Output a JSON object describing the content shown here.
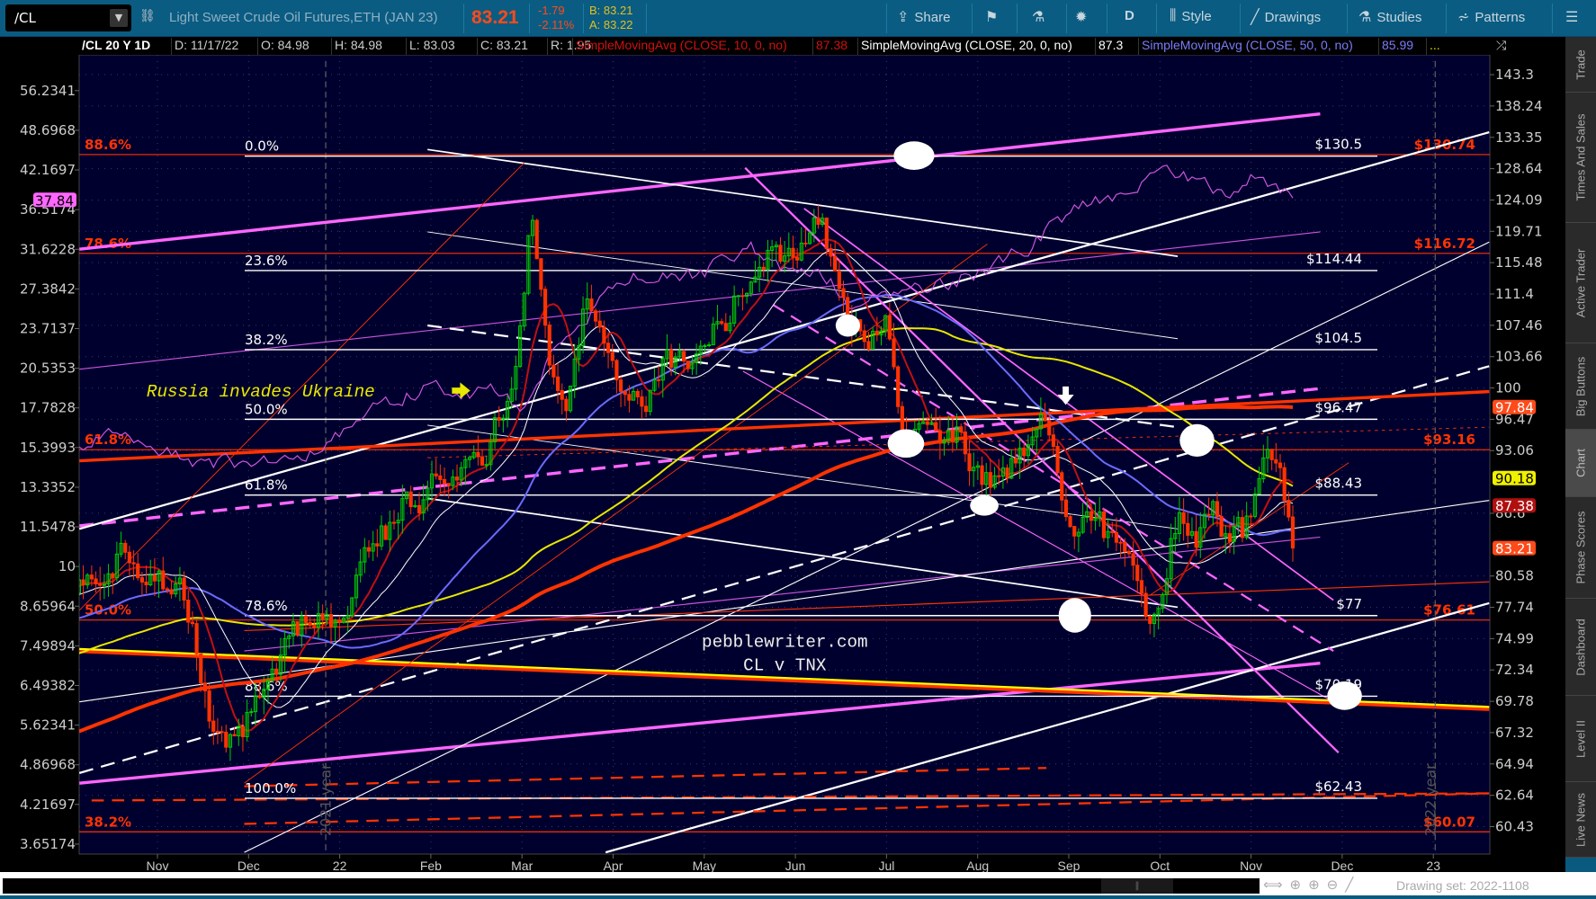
{
  "toolbar": {
    "symbol": "/CL",
    "description": "Light Sweet Crude Oil Futures,ETH (JAN 23)",
    "last": "83.21",
    "change": "-1.79",
    "change_pct": "-2.11%",
    "bid": "B: 83.21",
    "ask": "A: 83.22",
    "share": "Share",
    "period": "D",
    "style": "Style",
    "drawings": "Drawings",
    "studies": "Studies",
    "patterns": "Patterns"
  },
  "info_bar": {
    "title": "/CL 20 Y 1D",
    "date": "D: 11/17/22",
    "open": "O: 84.98",
    "high": "H: 84.98",
    "low": "L: 83.03",
    "close": "C: 83.21",
    "range": "R: 1.95",
    "sma10": "SimpleMovingAvg (CLOSE, 10, 0, no)",
    "sma10_val": "87.38",
    "sma20": "SimpleMovingAvg (CLOSE, 20, 0, no)",
    "sma20_val": "87.3",
    "sma50": "SimpleMovingAvg (CLOSE, 50, 0, no)",
    "sma50_val": "85.99",
    "more": "..."
  },
  "side_tabs": [
    "Trade",
    "Times And Sales",
    "Active Trader",
    "Big Buttons",
    "Chart",
    "Phase Scores",
    "Dashboard",
    "Level II",
    "Live News"
  ],
  "bottom": {
    "drawing_set": "Drawing set: 2022-1108"
  },
  "colors": {
    "bg": "#00002e",
    "up": "#00cc00",
    "down": "#ff3300",
    "sma10": "#c01010",
    "sma20": "#ffffff",
    "sma50": "#6b6bff",
    "sma100": "#e8e800",
    "sma200": "#ff3300",
    "tnx": "#cc55dd",
    "fib": "#ffffff",
    "fib_red": "#ff3300"
  },
  "chart_data": {
    "type": "candlestick",
    "title": "/CL 20 Y 1D",
    "right_axis_ticks": [
      "143.3",
      "138.24",
      "133.35",
      "128.64",
      "124.09",
      "119.71",
      "115.48",
      "111.4",
      "107.46",
      "103.66",
      "100",
      "96.47",
      "93.06",
      "86.6",
      "80.58",
      "77.74",
      "74.99",
      "72.34",
      "69.78",
      "67.32",
      "64.94",
      "62.64",
      "60.43"
    ],
    "left_axis_ticks": [
      "56.2341",
      "48.6968",
      "42.1697",
      "36.5174",
      "31.6228",
      "27.3842",
      "23.7137",
      "20.5353",
      "17.7828",
      "15.3993",
      "13.3352",
      "11.5478",
      "10",
      "8.65964",
      "7.49894",
      "6.49382",
      "5.62341",
      "4.86968",
      "4.21697",
      "3.65174"
    ],
    "x_ticks": [
      "Nov",
      "Dec",
      "22",
      "Feb",
      "Mar",
      "Apr",
      "May",
      "Jun",
      "Jul",
      "Aug",
      "Sep",
      "Oct",
      "Nov",
      "Dec",
      "23"
    ],
    "price_markers": [
      {
        "label": "97.84",
        "color": "#ff4a1a",
        "text": "#ffffff"
      },
      {
        "label": "90.18",
        "color": "#f0f000",
        "text": "#000000"
      },
      {
        "label": "87.38",
        "color": "#b01010",
        "text": "#ffffff"
      },
      {
        "label": "83.21",
        "color": "#ff4a1a",
        "text": "#ffffff"
      }
    ],
    "left_marker": {
      "label": "37.84",
      "color": "#ff66ff"
    },
    "price_path_month_index": [
      [
        -0.86,
        80
      ],
      [
        -0.5,
        83
      ],
      [
        0,
        81
      ],
      [
        0.3,
        78
      ],
      [
        0.6,
        68
      ],
      [
        0.85,
        66
      ],
      [
        1.2,
        72
      ],
      [
        1.6,
        76
      ],
      [
        2.0,
        77
      ],
      [
        2.3,
        83
      ],
      [
        2.8,
        88
      ],
      [
        3.2,
        92
      ],
      [
        3.6,
        92
      ],
      [
        3.9,
        100
      ],
      [
        4.1,
        123
      ],
      [
        4.3,
        105
      ],
      [
        4.5,
        100
      ],
      [
        4.7,
        112
      ],
      [
        5.0,
        100
      ],
      [
        5.3,
        98
      ],
      [
        5.6,
        103
      ],
      [
        6.0,
        105
      ],
      [
        6.3,
        110
      ],
      [
        6.6,
        115
      ],
      [
        7.0,
        118
      ],
      [
        7.3,
        120
      ],
      [
        7.5,
        110
      ],
      [
        7.7,
        107
      ],
      [
        8.0,
        108
      ],
      [
        8.2,
        95
      ],
      [
        8.5,
        97
      ],
      [
        8.8,
        95
      ],
      [
        9.1,
        90
      ],
      [
        9.4,
        92
      ],
      [
        9.7,
        96
      ],
      [
        10.0,
        87
      ],
      [
        10.3,
        86
      ],
      [
        10.6,
        82
      ],
      [
        10.85,
        77
      ],
      [
        11.0,
        79
      ],
      [
        11.2,
        87
      ],
      [
        11.4,
        85
      ],
      [
        11.6,
        86
      ],
      [
        11.9,
        84
      ],
      [
        12.1,
        88
      ],
      [
        12.2,
        92
      ],
      [
        12.35,
        88
      ],
      [
        12.5,
        83.21
      ]
    ],
    "tnx_path_month_index": [
      [
        -0.86,
        15.5
      ],
      [
        -0.5,
        16
      ],
      [
        0,
        15.2
      ],
      [
        0.5,
        14.5
      ],
      [
        1.0,
        14.6
      ],
      [
        1.5,
        14.8
      ],
      [
        2.0,
        16
      ],
      [
        2.3,
        17.5
      ],
      [
        2.7,
        18.5
      ],
      [
        3.0,
        19.3
      ],
      [
        3.3,
        18.6
      ],
      [
        3.8,
        19
      ],
      [
        4.0,
        17.5
      ],
      [
        4.3,
        21
      ],
      [
        4.7,
        24
      ],
      [
        5.0,
        28
      ],
      [
        5.3,
        29
      ],
      [
        5.6,
        28.5
      ],
      [
        6.0,
        29
      ],
      [
        6.5,
        32
      ],
      [
        6.7,
        30
      ],
      [
        7.0,
        28.5
      ],
      [
        7.3,
        29
      ],
      [
        7.6,
        26
      ],
      [
        8.0,
        27
      ],
      [
        8.5,
        27.8
      ],
      [
        9.0,
        29
      ],
      [
        9.4,
        31
      ],
      [
        9.7,
        33
      ],
      [
        10.0,
        36
      ],
      [
        10.3,
        38
      ],
      [
        10.6,
        39
      ],
      [
        11.0,
        42
      ],
      [
        11.3,
        41
      ],
      [
        11.5,
        40
      ],
      [
        11.8,
        39
      ],
      [
        12.1,
        42
      ],
      [
        12.3,
        39
      ],
      [
        12.5,
        37.84
      ]
    ],
    "fib_levels": [
      {
        "pct": "0.0%",
        "price": 130.5,
        "label": "$130.5"
      },
      {
        "pct": "23.6%",
        "price": 114.44,
        "label": "$114.44"
      },
      {
        "pct": "38.2%",
        "price": 104.5,
        "label": "$104.5"
      },
      {
        "pct": "50.0%",
        "price": 96.47,
        "label": "$96.47"
      },
      {
        "pct": "61.8%",
        "price": 88.43,
        "label": "$88.43"
      },
      {
        "pct": "78.6%",
        "price": 77,
        "label": "$77"
      },
      {
        "pct": "88.6%",
        "price": 70.19,
        "label": "$70.19"
      },
      {
        "pct": "100.0%",
        "price": 62.43,
        "label": "$62.43"
      }
    ],
    "fib_red_levels": [
      {
        "pct": "88.6%",
        "price": 130.74,
        "label": "$130.74"
      },
      {
        "pct": "78.6%",
        "price": 116.72,
        "label": "$116.72"
      },
      {
        "pct": "61.8%",
        "price": 93.16,
        "label": "$93.16"
      },
      {
        "pct": "50.0%",
        "price": 76.61,
        "label": "$76.61"
      },
      {
        "pct": "38.2%",
        "price": 60.07,
        "label": "$60.07"
      }
    ],
    "annotations": {
      "event": "Russia invades Ukraine",
      "watermark": "pebblewriter.com",
      "subtitle": "CL v TNX",
      "year_2021": "2021 year",
      "year_2022": "2022 year"
    }
  }
}
